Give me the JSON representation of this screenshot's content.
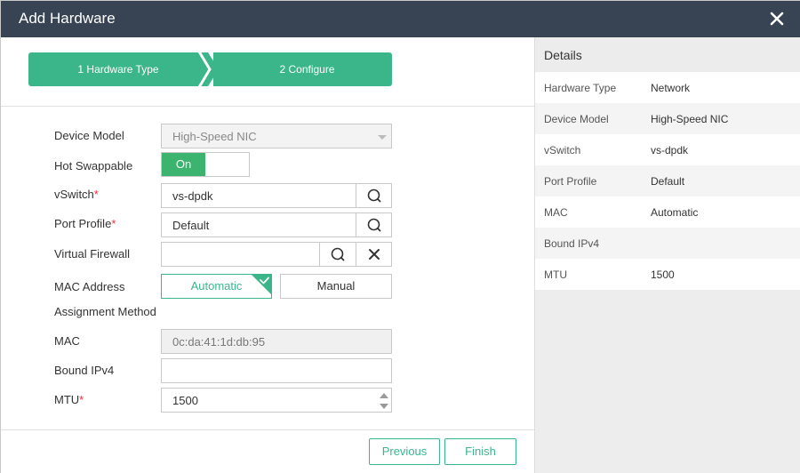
{
  "dialog": {
    "title": "Add Hardware",
    "close_icon": "close-icon"
  },
  "wizard": {
    "steps": [
      {
        "label": "1 Hardware Type"
      },
      {
        "label": "2 Configure"
      }
    ]
  },
  "form": {
    "device_model": {
      "label": "Device Model",
      "value": "High-Speed NIC"
    },
    "hot_swappable": {
      "label": "Hot Swappable",
      "state": "On"
    },
    "vswitch": {
      "label": "vSwitch",
      "required_mark": "*",
      "value": "vs-dpdk"
    },
    "port_profile": {
      "label": "Port Profile",
      "required_mark": "*",
      "value": "Default"
    },
    "virtual_firewall": {
      "label": "Virtual Firewall",
      "value": ""
    },
    "mac_method": {
      "label_line1": "MAC Address",
      "label_line2": "Assignment Method",
      "options": [
        "Automatic",
        "Manual"
      ],
      "selected": "Automatic"
    },
    "mac": {
      "label": "MAC",
      "value": "0c:da:41:1d:db:95"
    },
    "bound_ipv4": {
      "label": "Bound IPv4",
      "value": ""
    },
    "mtu": {
      "label": "MTU",
      "required_mark": "*",
      "value": "1500"
    }
  },
  "buttons": {
    "previous": "Previous",
    "finish": "Finish"
  },
  "details": {
    "title": "Details",
    "rows": [
      {
        "key": "Hardware Type",
        "value": "Network"
      },
      {
        "key": "Device Model",
        "value": "High-Speed NIC"
      },
      {
        "key": "vSwitch",
        "value": "vs-dpdk"
      },
      {
        "key": "Port Profile",
        "value": "Default"
      },
      {
        "key": "MAC",
        "value": "Automatic"
      },
      {
        "key": "Bound IPv4",
        "value": ""
      },
      {
        "key": "MTU",
        "value": "1500"
      }
    ]
  },
  "colors": {
    "titlebar": "#384454",
    "accent": "#3bb58a",
    "toggle_on": "#3cb36e",
    "required": "#e33333"
  }
}
